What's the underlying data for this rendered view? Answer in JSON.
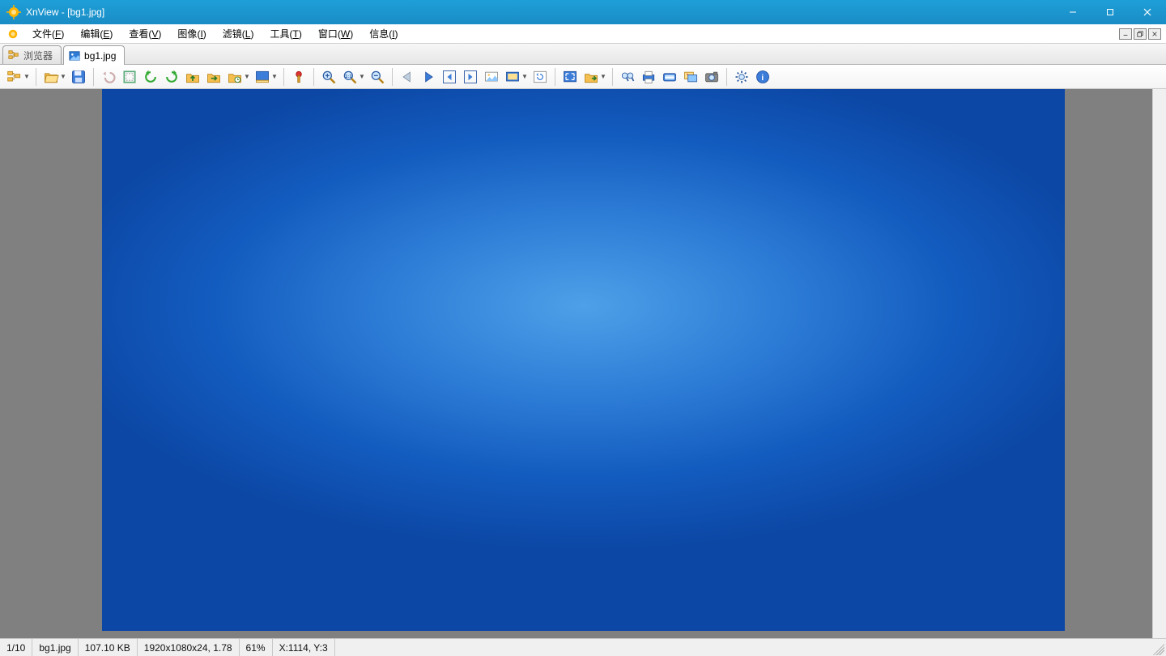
{
  "titlebar": {
    "text": "XnView - [bg1.jpg]"
  },
  "menu": {
    "items": [
      {
        "label": "文件",
        "accel": "F"
      },
      {
        "label": "编辑",
        "accel": "E"
      },
      {
        "label": "查看",
        "accel": "V"
      },
      {
        "label": "图像",
        "accel": "I"
      },
      {
        "label": "滤镜",
        "accel": "L"
      },
      {
        "label": "工具",
        "accel": "T"
      },
      {
        "label": "窗口",
        "accel": "W"
      },
      {
        "label": "信息",
        "accel": "I"
      }
    ]
  },
  "tabs": {
    "browser_label": "浏览器",
    "file_label": "bg1.jpg"
  },
  "status": {
    "index": "1/10",
    "filename": "bg1.jpg",
    "filesize": "107.10 KB",
    "dims": "1920x1080x24, 1.78",
    "zoom": "61%",
    "coords": "X:1114, Y:3"
  }
}
